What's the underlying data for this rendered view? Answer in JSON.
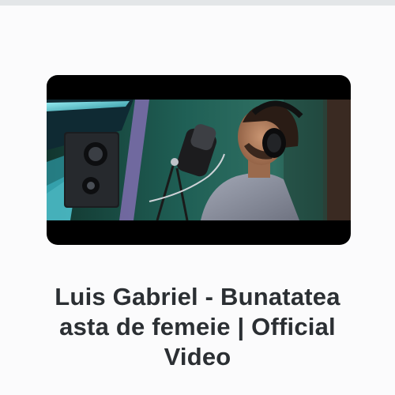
{
  "video": {
    "title_lines": [
      "Luis Gabriel - Bunatatea",
      "asta de femeie | Official",
      "Video"
    ]
  },
  "colors": {
    "background": "#fbfbfc",
    "title_text": "#2b2f33",
    "thumbnail_frame": "#000000",
    "scene_teal": "#1f5f5a",
    "scene_cyan_light": "#7fe6ef"
  },
  "icons": {
    "thumbnail": "video-thumbnail"
  }
}
